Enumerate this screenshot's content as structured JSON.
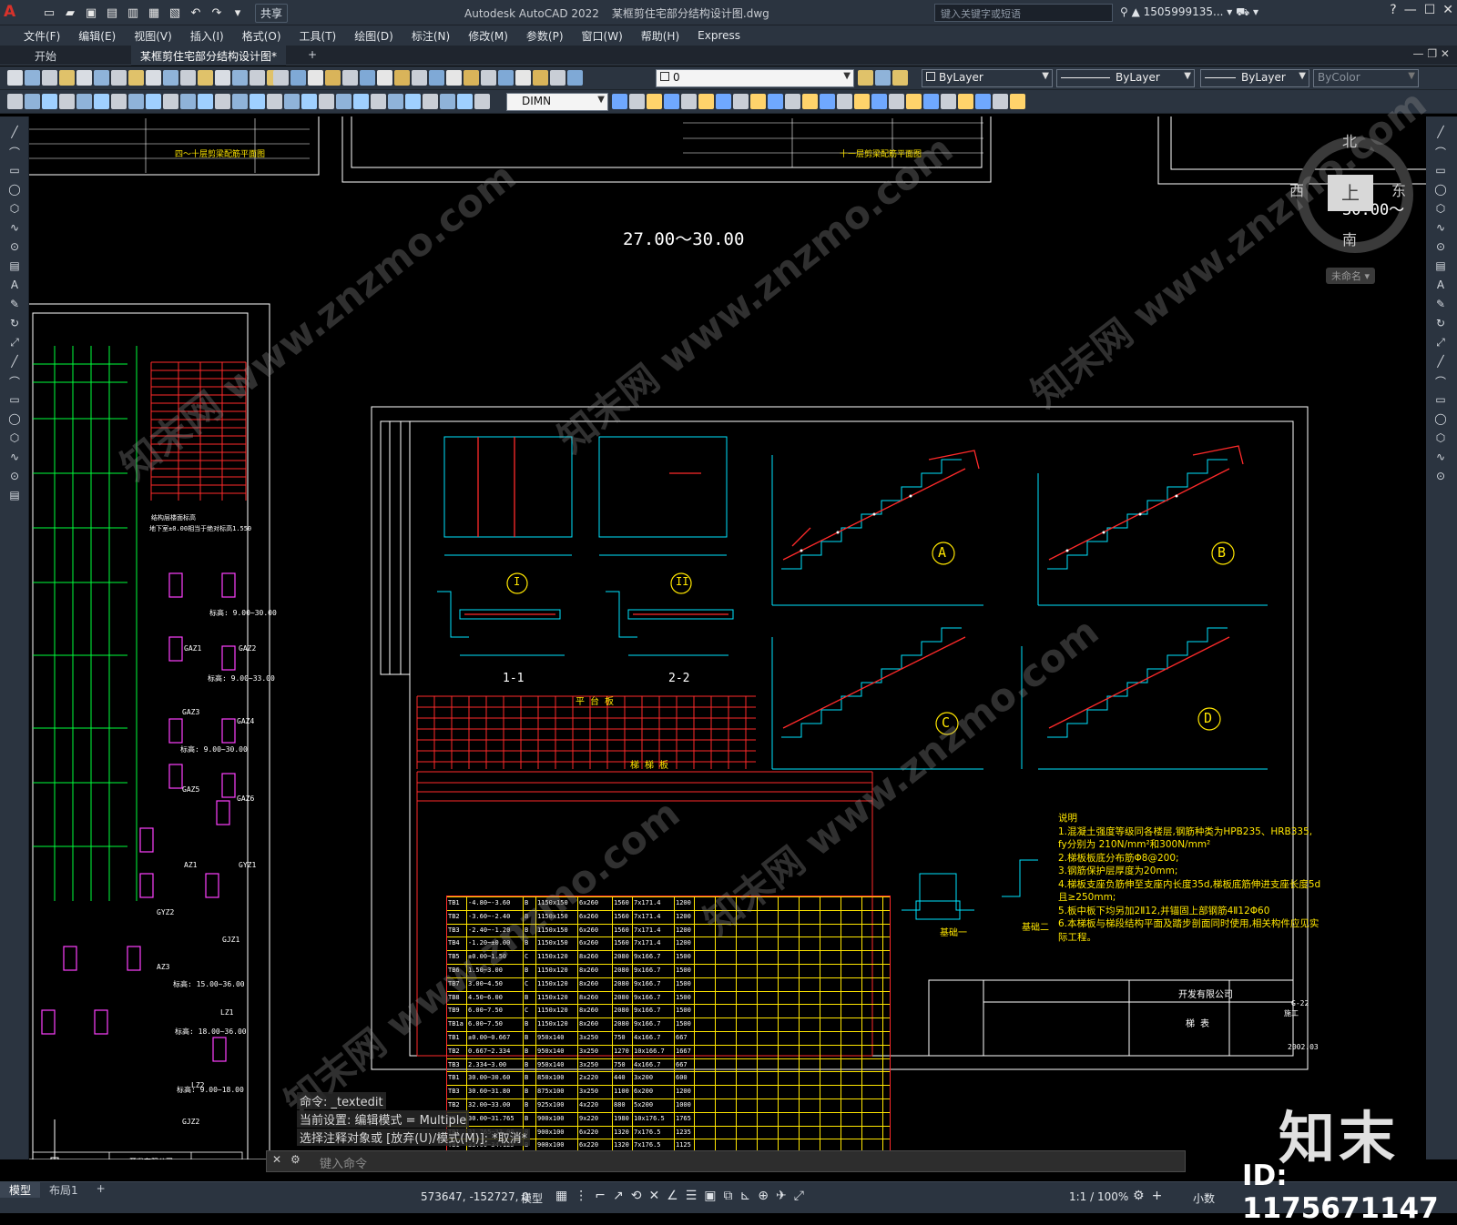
{
  "app": {
    "name": "Autodesk AutoCAD 2022",
    "file": "某框剪住宅部分结构设计图.dwg",
    "logo": "A"
  },
  "qat": {
    "share_label": "共享"
  },
  "search": {
    "placeholder": "键入关键字或短语"
  },
  "user": {
    "name": "1505999135..."
  },
  "menu": [
    "文件(F)",
    "编辑(E)",
    "视图(V)",
    "插入(I)",
    "格式(O)",
    "工具(T)",
    "绘图(D)",
    "标注(N)",
    "修改(M)",
    "参数(P)",
    "窗口(W)",
    "帮助(H)",
    "Express"
  ],
  "tabs": {
    "start": "开始",
    "doc": "某框剪住宅部分结构设计图*",
    "add": "+"
  },
  "toolbar": {
    "layer": "0",
    "color": "ByLayer",
    "linetype": "ByLayer",
    "lineweight": "ByLayer",
    "plotstyle": "ByColor",
    "dimstyle": "DIMN"
  },
  "compass": {
    "north": "北",
    "south": "南",
    "west": "西",
    "east": "东",
    "top": "上",
    "ucs_name": "未命名"
  },
  "drawing": {
    "elev_label": "27.00～30.00",
    "elev_label2": "30.00～",
    "title_top_left": "四～十层剪梁配筋平面图",
    "title_top_mid": "十一层剪梁配筋平面图",
    "section_1": "1-1",
    "section_2": "2-2",
    "detail_I": "I",
    "detail_II": "II",
    "type_A": "A",
    "type_B": "B",
    "type_C": "C",
    "type_D": "D",
    "table1_title": "平 台 板",
    "table2_title": "梯 梯 板",
    "notes_title": "说明",
    "notes": [
      "1.混凝土强度等级同各楼层,钢筋种类为HPB235、HRB335,",
      "  fy分别为 210N/mm²和300N/mm²",
      "2.梯板板底分布筋Φ8@200;",
      "3.钢筋保护层厚度为20mm;",
      "4.梯板支座负筋伸至支座内长度35d,梯板底筋伸进支座长度5d且≥250mm;",
      "5.板中板下均另加2Ⅱ12,并锚固上部钢筋4Ⅱ12Φ60",
      "6.本梯板与梯段结构平面及踏步剖面同时使用,相关构件应见实际工程。"
    ],
    "foundation_1": "基础一",
    "foundation_2": "基础二",
    "company": "开发有限公司",
    "sheet_title": "梯 表",
    "sheet_no": "G-22",
    "date": "2002.03",
    "stage": "施工",
    "rows": [
      [
        "TB1",
        "-4.80~-3.60",
        "B",
        "1150x150",
        "6x260",
        "1560",
        "7x171.4",
        "1200"
      ],
      [
        "TB2",
        "-3.60~-2.40",
        "B",
        "1150x150",
        "6x260",
        "1560",
        "7x171.4",
        "1200"
      ],
      [
        "TB3",
        "-2.40~-1.20",
        "B",
        "1150x150",
        "6x260",
        "1560",
        "7x171.4",
        "1200"
      ],
      [
        "TB4",
        "-1.20~±0.00",
        "B",
        "1150x150",
        "6x260",
        "1560",
        "7x171.4",
        "1200"
      ],
      [
        "TB5",
        "±0.00~1.50",
        "C",
        "1150x120",
        "8x260",
        "2080",
        "9x166.7",
        "1500"
      ],
      [
        "TB6",
        "1.50~3.00",
        "B",
        "1150x120",
        "8x260",
        "2080",
        "9x166.7",
        "1500"
      ],
      [
        "TB7",
        "3.00~4.50",
        "C",
        "1150x120",
        "8x260",
        "2080",
        "9x166.7",
        "1500"
      ],
      [
        "TB8",
        "4.50~6.00",
        "B",
        "1150x120",
        "8x260",
        "2080",
        "9x166.7",
        "1500"
      ],
      [
        "TB9",
        "6.00~7.50",
        "C",
        "1150x120",
        "8x260",
        "2080",
        "9x166.7",
        "1500"
      ],
      [
        "TB1a",
        "6.00~7.50",
        "B",
        "1150x120",
        "8x260",
        "2080",
        "9x166.7",
        "1500"
      ],
      [
        "TB1",
        "±0.00~0.667",
        "B",
        "950x140",
        "3x250",
        "750",
        "4x166.7",
        "667"
      ],
      [
        "TB2",
        "0.667~2.334",
        "B",
        "950x140",
        "3x250",
        "1270",
        "10x166.7",
        "1667"
      ],
      [
        "TB3",
        "2.334~3.00",
        "B",
        "950x140",
        "3x250",
        "750",
        "4x166.7",
        "667"
      ],
      [
        "TB1",
        "30.00~30.60",
        "B",
        "850x100",
        "2x220",
        "440",
        "3x200",
        "600"
      ],
      [
        "TB3",
        "30.60~31.80",
        "B",
        "875x100",
        "3x250",
        "1100",
        "6x200",
        "1200"
      ],
      [
        "TB2",
        "32.00~33.00",
        "B",
        "925x100",
        "4x220",
        "880",
        "5x200",
        "1000"
      ],
      [
        "TB1",
        "30.00~31.765",
        "B",
        "900x100",
        "9x220",
        "1980",
        "10x176.5",
        "1765"
      ],
      [
        "TB1",
        "31.765~33.00",
        "B",
        "900x100",
        "6x220",
        "1320",
        "7x176.5",
        "1235"
      ],
      [
        "TB1",
        "33.00~34.125",
        "B",
        "900x100",
        "6x220",
        "1320",
        "7x176.5",
        "1125"
      ]
    ],
    "left_sheet_labels": [
      "GAZ1",
      "GAZ2",
      "GAZ3",
      "GAZ4",
      "GAZ5",
      "GAZ6",
      "AZ1",
      "GYZ1",
      "GYZ2",
      "GJZ1",
      "AZ3",
      "LZ1",
      "LZ2",
      "GJZ2"
    ],
    "left_marks": [
      "标高: 9.00~30.00",
      "标高: 9.00~33.00",
      "标高: 9.00~30.00",
      "标高: 15.00~36.00",
      "标高: 18.00~36.00",
      "标高: 9.00~18.00"
    ],
    "left_table_title": "结构层楼面标高",
    "left_note": "地下室±0.00相当于绝对标高1.550"
  },
  "command": {
    "history": [
      "命令: _textedit",
      "当前设置: 编辑模式 = Multiple",
      "选择注释对象或 [放弃(U)/模式(M)]: *取消*"
    ],
    "placeholder": "键入命令"
  },
  "status": {
    "coords": "573647, -152727, 0",
    "space": "模型",
    "scale": "1:1 / 100%",
    "units": "小数"
  },
  "layouts": {
    "model": "模型",
    "layout1": "布局1",
    "add": "+"
  },
  "watermark": {
    "logo": "知末",
    "id": "ID: 1175671147",
    "site": "知末网 www.znzmo.com"
  }
}
